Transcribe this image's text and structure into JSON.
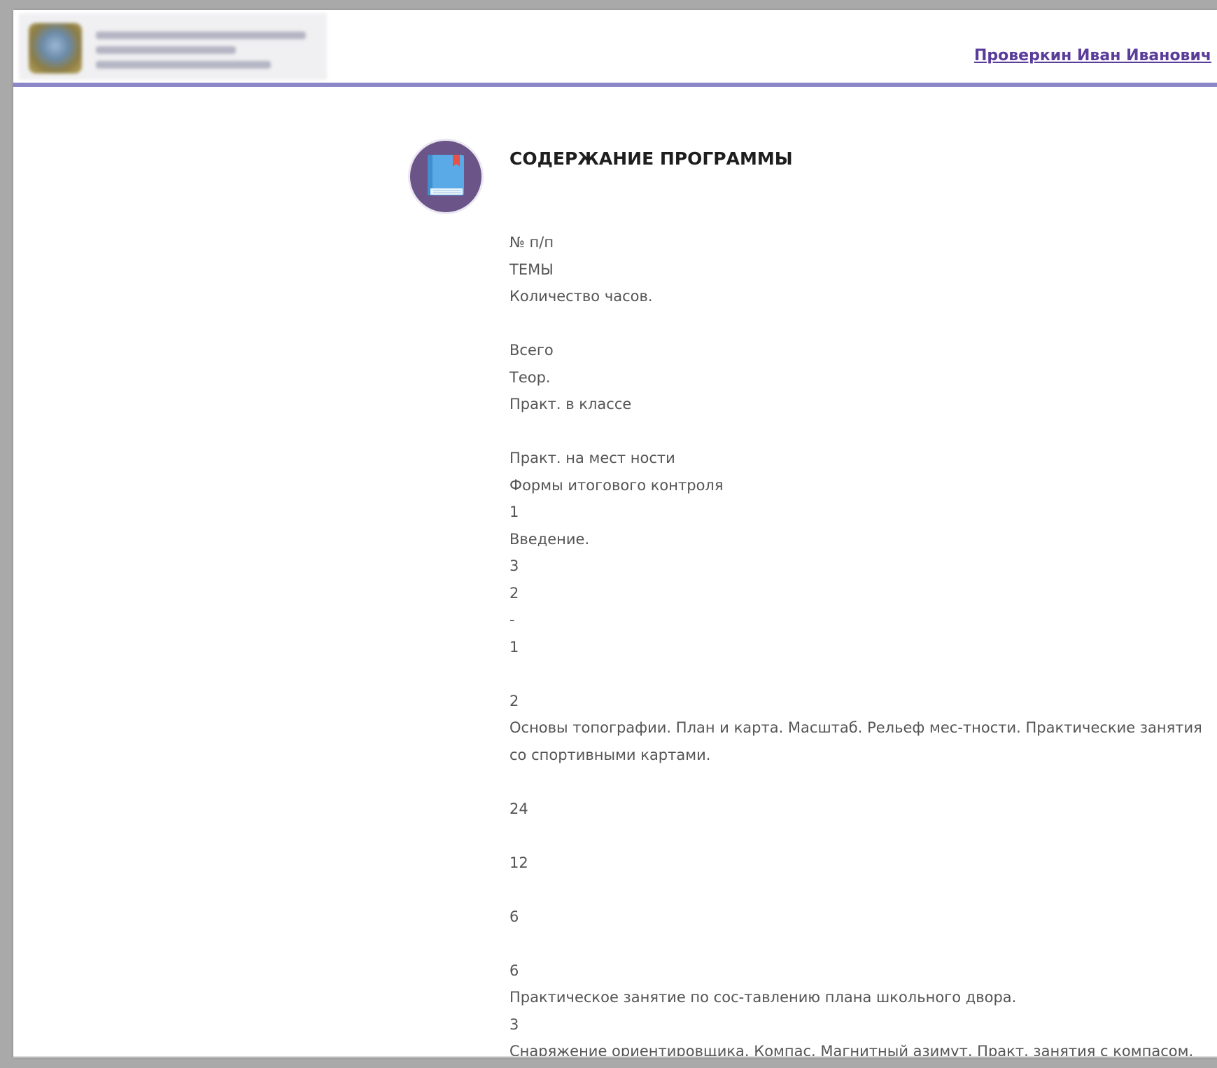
{
  "header": {
    "user_name": "Проверкин Иван Иванович"
  },
  "section": {
    "icon": "book-icon",
    "title": "СОДЕРЖАНИЕ ПРОГРАММЫ"
  },
  "content": {
    "lines": [
      "№ п/п",
      "ТЕМЫ",
      "Количество часов.",
      "",
      "Всего",
      "Теор.",
      "Практ. в классе",
      "",
      "Практ. на мест ности",
      "Формы итогового контроля",
      "1",
      "Введение.",
      "3",
      "2",
      "-",
      "1",
      "",
      "2",
      "Основы топографии. План и карта. Масштаб. Рельеф мес-тности. Практические занятия со спортивными картами.",
      "",
      "24",
      "",
      "12",
      "",
      "6",
      "",
      "6",
      "Практическое занятие по сос-тавлению плана школьного двора.",
      "3",
      "Снаряжение ориентировщика. Компас. Магнитный азимут. Практ. занятия с компасом."
    ]
  },
  "colors": {
    "accent_bar": "#8b87c9",
    "user_link": "#5a3c9a",
    "icon_circle": "#6b5588",
    "book_blue": "#5aaae8",
    "bookmark_red": "#e8504a"
  }
}
